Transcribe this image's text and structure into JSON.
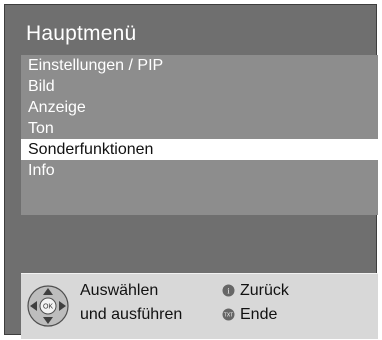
{
  "menu": {
    "title": "Hauptmenü",
    "items": [
      {
        "label": "Einstellungen / PIP",
        "selected": false
      },
      {
        "label": "Bild",
        "selected": false
      },
      {
        "label": "Anzeige",
        "selected": false
      },
      {
        "label": "Ton",
        "selected": false
      },
      {
        "label": "Sonderfunktionen",
        "selected": true
      },
      {
        "label": "Info",
        "selected": false
      }
    ]
  },
  "footer": {
    "nav_label": "OK",
    "line1_left": "Auswählen",
    "line2_left": "und ausführen",
    "back_label": "Zurück",
    "end_label": "Ende",
    "back_icon_text": "i",
    "end_icon_text": "TXT"
  }
}
